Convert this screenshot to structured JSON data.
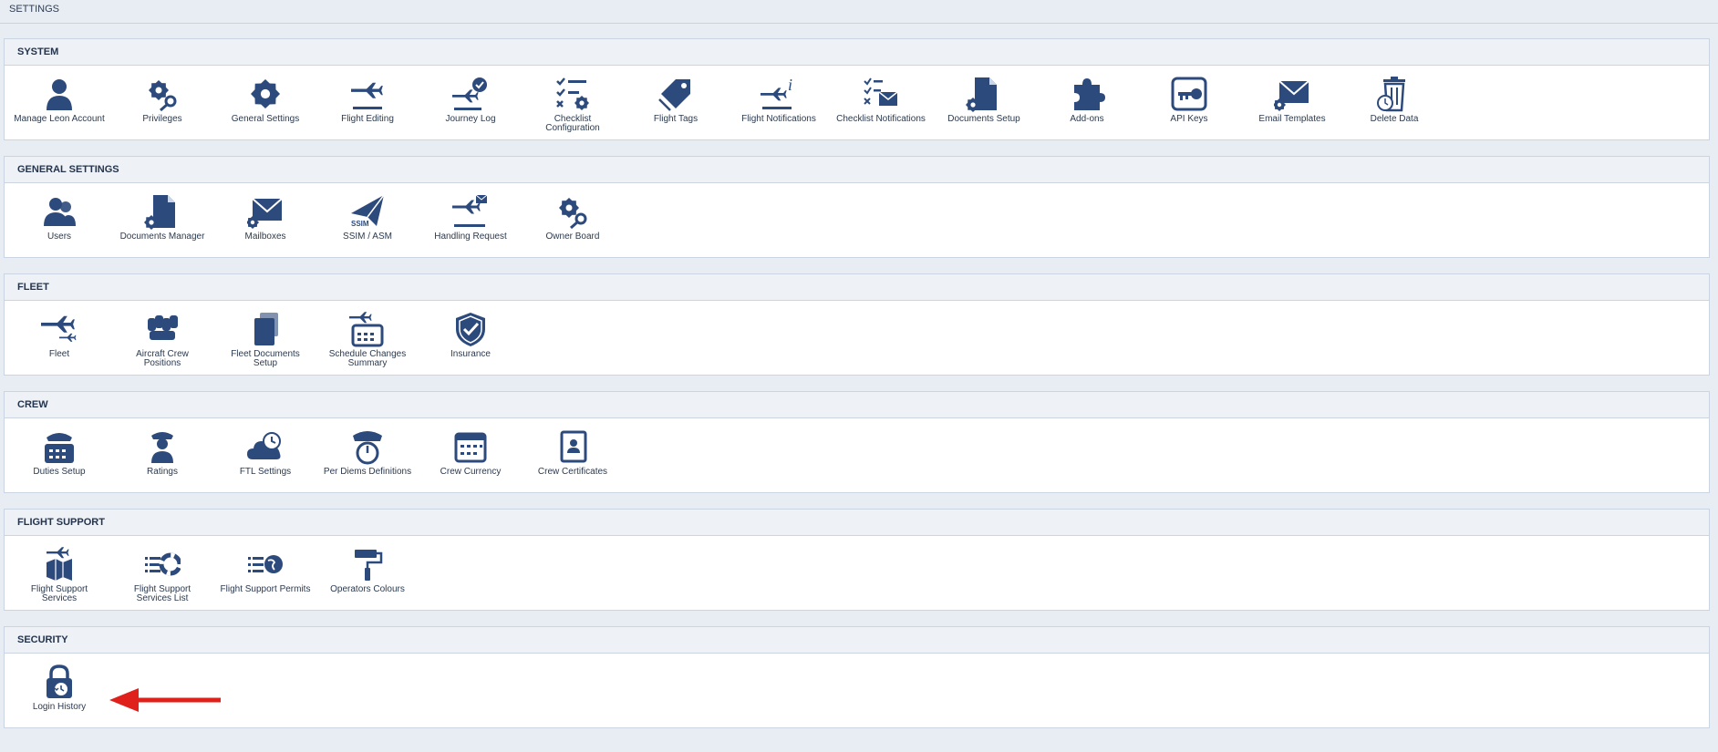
{
  "page": {
    "title": "SETTINGS"
  },
  "sections": [
    {
      "title": "SYSTEM",
      "items": [
        {
          "label": "Manage Leon Account",
          "icon": "user-icon"
        },
        {
          "label": "Privileges",
          "icon": "gears-key-icon"
        },
        {
          "label": "General Settings",
          "icon": "gear-icon"
        },
        {
          "label": "Flight Editing",
          "icon": "plane-landing-icon"
        },
        {
          "label": "Journey Log",
          "icon": "plane-check-icon"
        },
        {
          "label": "Checklist Configuration",
          "icon": "checklist-gear-icon"
        },
        {
          "label": "Flight Tags",
          "icon": "tags-icon"
        },
        {
          "label": "Flight Notifications",
          "icon": "plane-info-icon"
        },
        {
          "label": "Checklist Notifications",
          "icon": "checklist-mail-icon"
        },
        {
          "label": "Documents Setup",
          "icon": "document-gear-icon"
        },
        {
          "label": "Add-ons",
          "icon": "puzzle-icon"
        },
        {
          "label": "API Keys",
          "icon": "key-icon"
        },
        {
          "label": "Email Templates",
          "icon": "mail-gear-icon"
        },
        {
          "label": "Delete Data",
          "icon": "trash-clock-icon"
        }
      ]
    },
    {
      "title": "GENERAL SETTINGS",
      "items": [
        {
          "label": "Users",
          "icon": "users-icon"
        },
        {
          "label": "Documents Manager",
          "icon": "document-gear-icon"
        },
        {
          "label": "Mailboxes",
          "icon": "mail-gear-icon"
        },
        {
          "label": "SSIM / ASM",
          "icon": "paper-plane-icon"
        },
        {
          "label": "Handling Request",
          "icon": "plane-mail-icon"
        },
        {
          "label": "Owner Board",
          "icon": "gears-key-icon"
        }
      ]
    },
    {
      "title": "FLEET",
      "items": [
        {
          "label": "Fleet",
          "icon": "planes-icon"
        },
        {
          "label": "Aircraft Crew Positions",
          "icon": "crew-positions-icon"
        },
        {
          "label": "Fleet Documents Setup",
          "icon": "fleet-documents-icon"
        },
        {
          "label": "Schedule Changes Summary",
          "icon": "plane-calendar-icon"
        },
        {
          "label": "Insurance",
          "icon": "shield-check-icon"
        }
      ]
    },
    {
      "title": "CREW",
      "items": [
        {
          "label": "Duties Setup",
          "icon": "pilot-calendar-icon"
        },
        {
          "label": "Ratings",
          "icon": "pilot-icon"
        },
        {
          "label": "FTL Settings",
          "icon": "cloud-clock-icon"
        },
        {
          "label": "Per Diems Definitions",
          "icon": "pilot-gauge-icon"
        },
        {
          "label": "Crew Currency",
          "icon": "calendar-icon"
        },
        {
          "label": "Crew Certificates",
          "icon": "certificate-icon"
        }
      ]
    },
    {
      "title": "FLIGHT SUPPORT",
      "items": [
        {
          "label": "Flight Support Services",
          "icon": "plane-map-icon"
        },
        {
          "label": "Flight Support Services List",
          "icon": "list-lifebuoy-icon"
        },
        {
          "label": "Flight Support Permits",
          "icon": "list-globe-icon"
        },
        {
          "label": "Operators Colours",
          "icon": "paint-roller-icon"
        }
      ]
    },
    {
      "title": "SECURITY",
      "items": [
        {
          "label": "Login History",
          "icon": "lock-history-icon"
        }
      ]
    }
  ],
  "colors": {
    "icon": "#2d4a7c",
    "arrow": "#e0201b"
  }
}
